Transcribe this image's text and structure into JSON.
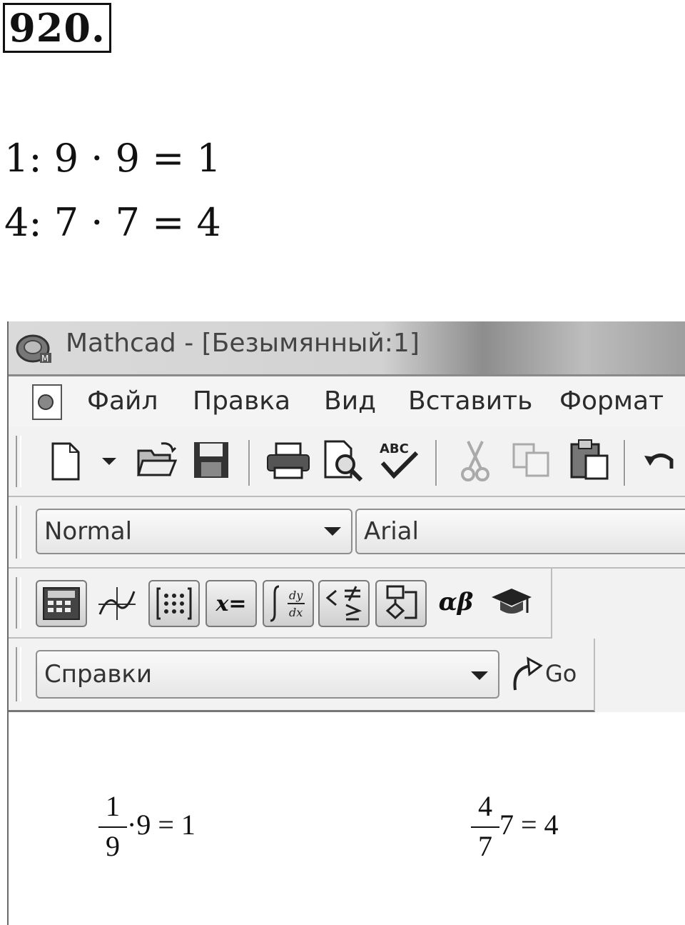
{
  "textbook": {
    "task_number": "920.",
    "equations": [
      "1: 9 · 9 = 1",
      "4: 7 · 7 = 4"
    ]
  },
  "window": {
    "title": "Mathcad - [Безымянный:1]"
  },
  "menu": {
    "items": [
      "Файл",
      "Правка",
      "Вид",
      "Вставить",
      "Формат"
    ]
  },
  "toolbar_standard": {
    "icons": [
      "new-document-icon",
      "dropdown-arrow-icon",
      "open-folder-icon",
      "save-icon",
      "print-icon",
      "print-preview-icon",
      "spell-check-icon",
      "cut-icon",
      "copy-icon",
      "paste-icon",
      "undo-icon"
    ],
    "spell_check_text": "ABC"
  },
  "toolbar_format": {
    "style_value": "Normal",
    "font_value": "Arial"
  },
  "toolbar_math": {
    "assign_label": "x=",
    "greek_label": "αβ"
  },
  "toolbar_resources": {
    "resource_value": "Справки",
    "go_label": "Go"
  },
  "worksheet": {
    "expr1": {
      "numerator": "1",
      "denominator": "9",
      "rest": "·9 = 1"
    },
    "expr2": {
      "numerator": "4",
      "denominator": "7",
      "rest": "7 = 4"
    }
  },
  "colors": {
    "titlebar_light": "#d2d2d2",
    "titlebar_dark": "#8d8d8d",
    "menu_text": "#2b2b2b"
  }
}
